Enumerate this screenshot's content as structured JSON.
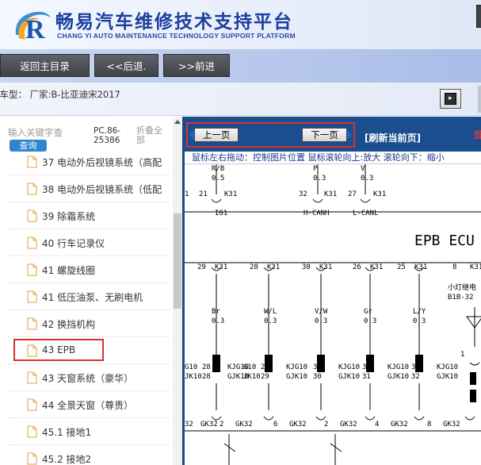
{
  "header": {
    "title_cn": "畅易汽车维修技术支持平台",
    "title_en": "CHANG YI AUTO MAINTENANCE TECHNOLOGY SUPPORT PLATFORM"
  },
  "nav": {
    "home": "返回主目录",
    "back": "<<后退.",
    "forward": ">>前进"
  },
  "info": {
    "vehicle": "前车型： 厂家:B-比亚迪宋2017"
  },
  "sidebar": {
    "search_placeholder": "输入关键字查",
    "query_label": "查询",
    "pc_line1": "PC.86-",
    "pc_line2": "25386",
    "collapse_line1": "折叠全",
    "collapse_line2": "部",
    "items": [
      {
        "label": "37 电动外后视镜系统（高配"
      },
      {
        "label": "38 电动外后视镜系统（低配"
      },
      {
        "label": "39 除霜系统"
      },
      {
        "label": "40 行车记录仪"
      },
      {
        "label": "41 螺旋线圈"
      },
      {
        "label": "41 低压油泵、无刷电机"
      },
      {
        "label": "42 换挡机构"
      },
      {
        "label": "43 EPB"
      },
      {
        "label": "43 天窗系统（豪华）"
      },
      {
        "label": "44 全景天窗（尊贵）"
      },
      {
        "label": "45.1 接地1"
      },
      {
        "label": "45.2 接地2"
      }
    ],
    "selected_index": 7
  },
  "viewer": {
    "prev_page": "上一页",
    "next_page": "下一页",
    "refresh": "[刷新当前页]",
    "red_text": "当",
    "hint": "鼠标左右拖动：控制图片位置 鼠标滚轮向上:放大  滚轮向下：缩小"
  },
  "diagram": {
    "top_wires": [
      {
        "color": "R/B",
        "gauge": "0.5"
      },
      {
        "color": "P",
        "gauge": "0.3"
      },
      {
        "color": "V",
        "gauge": "0.3"
      }
    ],
    "top_pins": [
      {
        "pin": "21",
        "conn": "K31",
        "sig": "IG1"
      },
      {
        "pin": "32",
        "conn": "K31",
        "sig": "H-CANH"
      },
      {
        "pin": "27",
        "conn": "K31",
        "sig": "L-CANL"
      }
    ],
    "ecu_label": "EPB ECU",
    "mid_pins": [
      {
        "pin": "29",
        "conn": "K31"
      },
      {
        "pin": "28",
        "conn": "K31"
      },
      {
        "pin": "30",
        "conn": "K31"
      },
      {
        "pin": "26",
        "conn": "K31"
      },
      {
        "pin": "25",
        "conn": "K31"
      },
      {
        "pin": "8",
        "conn": "K31"
      }
    ],
    "relay_label_1": "小灯继电",
    "relay_label_2": "B1B-32",
    "mid_wires": [
      {
        "color": "Br",
        "gauge": "0.3"
      },
      {
        "color": "W/L",
        "gauge": "0.3"
      },
      {
        "color": "V/W",
        "gauge": "0.3"
      },
      {
        "color": "Gr",
        "gauge": "0.3"
      },
      {
        "color": "L/Y",
        "gauge": "0.3"
      }
    ],
    "connectors": [
      {
        "left": "G10",
        "pin": "28",
        "a": "KJG10",
        "b": "GJK10",
        "pin2": "29"
      },
      {
        "left": "G10",
        "pin": "29",
        "a": "KJG10",
        "b": "GJK10",
        "pin2": "30"
      },
      {
        "left": "",
        "pin": "30",
        "a": "KJG10",
        "b": "GJK10",
        "pin2": "31"
      },
      {
        "left": "",
        "pin": "31",
        "a": "KJG10",
        "b": "GJK10",
        "pin2": "32"
      },
      {
        "left": "",
        "pin": "32",
        "a": "KJG10",
        "b": "GJK10",
        "pin2": "33"
      }
    ],
    "bottom_pins": [
      {
        "pin": "32",
        "conn": "GK32"
      },
      {
        "pin": "2",
        "conn": "GK32"
      },
      {
        "pin": "6",
        "conn": "GK32"
      },
      {
        "pin": "2",
        "conn": "GK32"
      },
      {
        "pin": "4",
        "conn": "GK32"
      },
      {
        "pin": "8",
        "conn": "GK32"
      }
    ],
    "right_pin": "1"
  }
}
